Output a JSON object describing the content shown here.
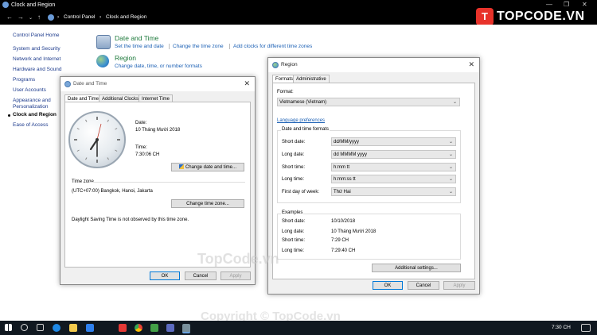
{
  "window": {
    "title": "Clock and Region",
    "controls": [
      "—",
      "❐",
      "✕"
    ]
  },
  "address": {
    "crumbs": [
      "Control Panel",
      "Clock and Region"
    ]
  },
  "sidebar": {
    "items": [
      {
        "label": "Control Panel Home"
      },
      {
        "label": "System and Security"
      },
      {
        "label": "Network and Internet"
      },
      {
        "label": "Hardware and Sound"
      },
      {
        "label": "Programs"
      },
      {
        "label": "User Accounts"
      },
      {
        "label": "Appearance and Personalization"
      },
      {
        "label": "Clock and Region"
      },
      {
        "label": "Ease of Access"
      }
    ]
  },
  "main": {
    "date_time": {
      "heading": "Date and Time",
      "links": [
        "Set the time and date",
        "Change the time zone",
        "Add clocks for different time zones"
      ]
    },
    "region": {
      "heading": "Region",
      "link": "Change date, time, or number formats"
    }
  },
  "logo": {
    "text": "TOPCODE.VN",
    "badge": "T"
  },
  "date_time_dialog": {
    "title": "Date and Time",
    "tabs": [
      "Date and Time",
      "Additional Clocks",
      "Internet Time"
    ],
    "date_label": "Date:",
    "date_value": "10 Tháng Mười 2018",
    "time_label": "Time:",
    "time_value": "7:30:06 CH",
    "change_dt_button": "Change date and time...",
    "tz_heading": "Time zone",
    "tz_value": "(UTC+07:00) Bangkok, Hanoi, Jakarta",
    "change_tz_button": "Change time zone...",
    "dst_note": "Daylight Saving Time is not observed by this time zone.",
    "ok": "OK",
    "cancel": "Cancel",
    "apply": "Apply"
  },
  "region_dialog": {
    "title": "Region",
    "tabs": [
      "Formats",
      "Administrative"
    ],
    "format_label": "Format:",
    "format_value": "Vietnamese (Vietnam)",
    "lang_pref": "Language preferences",
    "formats_group": "Date and time formats",
    "rows": [
      {
        "label": "Short date:",
        "value": "dd/MM/yyyy"
      },
      {
        "label": "Long date:",
        "value": "dd MMMM yyyy"
      },
      {
        "label": "Short time:",
        "value": "h:mm tt"
      },
      {
        "label": "Long time:",
        "value": "h:mm:ss tt"
      },
      {
        "label": "First day of week:",
        "value": "Thứ Hai"
      }
    ],
    "examples_group": "Examples",
    "examples": [
      {
        "label": "Short date:",
        "value": "10/10/2018"
      },
      {
        "label": "Long date:",
        "value": "10 Tháng Mười 2018"
      },
      {
        "label": "Short time:",
        "value": "7:29 CH"
      },
      {
        "label": "Long time:",
        "value": "7:29:40 CH"
      }
    ],
    "additional": "Additional settings...",
    "ok": "OK",
    "cancel": "Cancel",
    "apply": "Apply"
  },
  "watermarks": {
    "center": "TopCode.vn",
    "bottom": "Copyright © TopCode.vn"
  },
  "taskbar": {
    "time": "7:30 CH",
    "date": "10/10/2018"
  }
}
